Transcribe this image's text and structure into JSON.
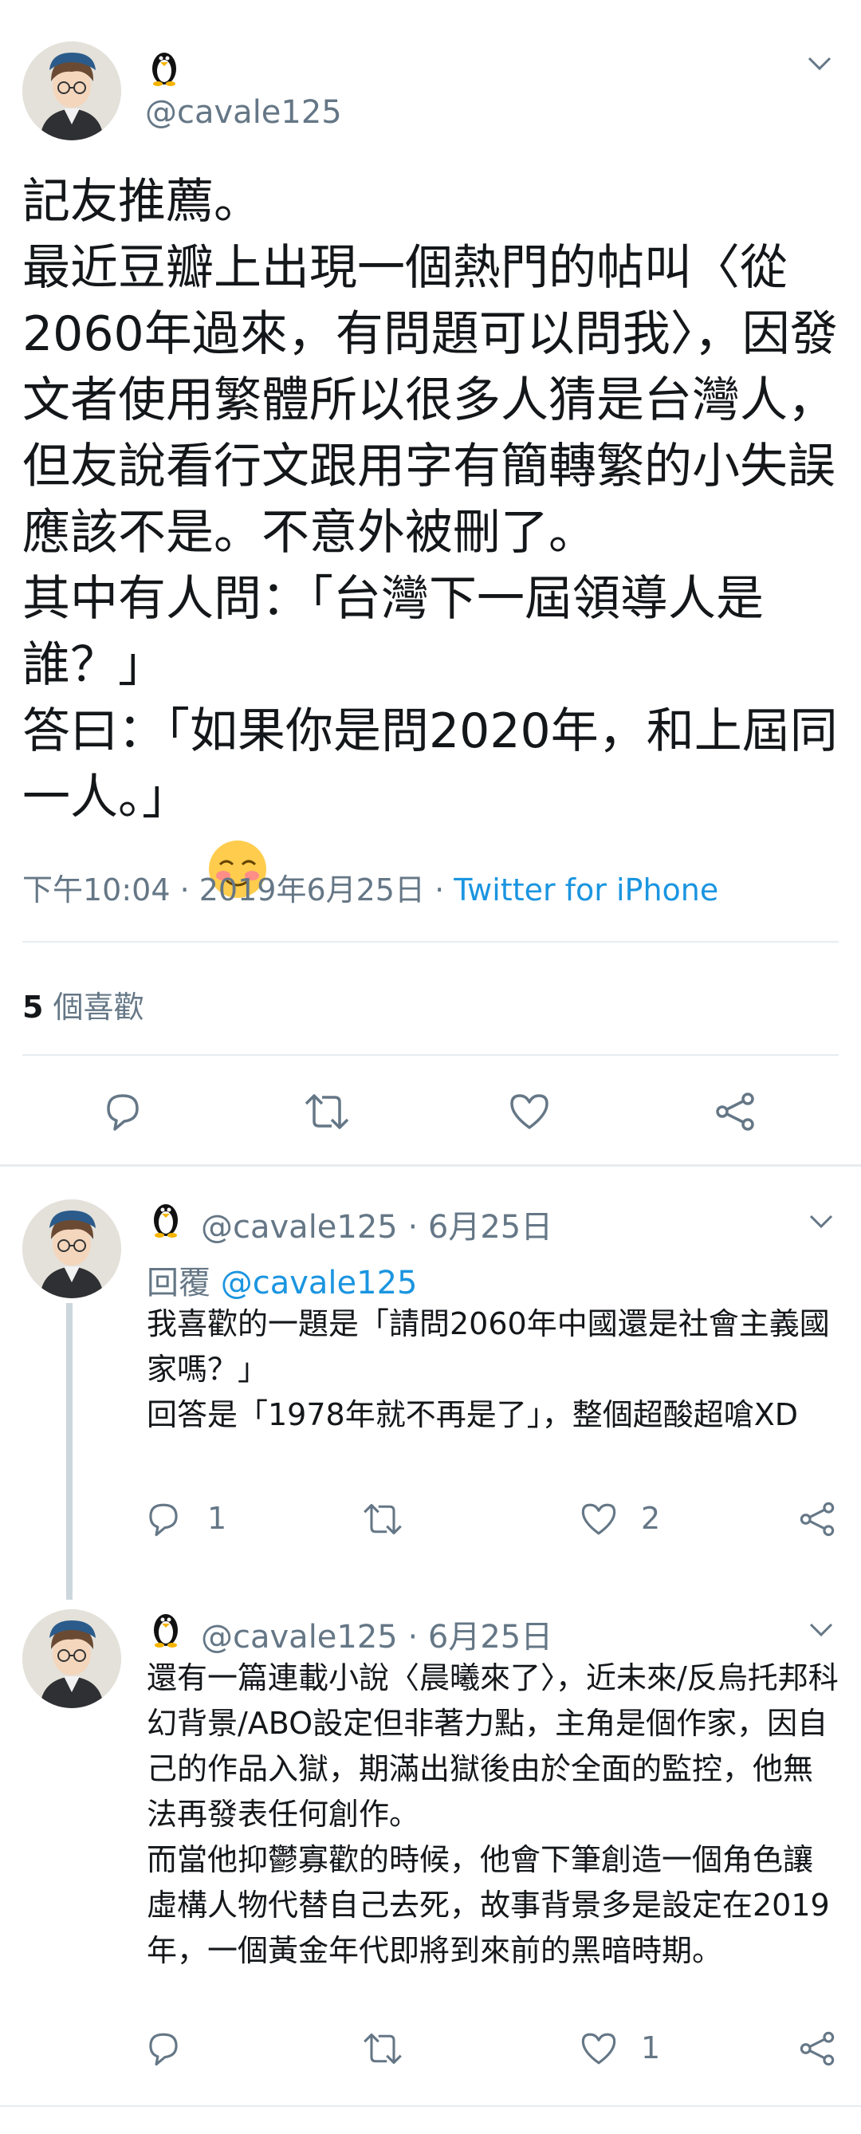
{
  "colors": {
    "text": "#14171a",
    "secondary": "#657786",
    "link": "#1b95e0",
    "divider": "#e6ecf0"
  },
  "main_tweet": {
    "avatar": "avatar-icon",
    "badge": "penguin-icon",
    "handle": "@cavale125",
    "text": "記友推薦。\n最近豆瓣上出現一個熱門的帖叫〈從2060年過來，有問題可以問我〉，因發文者使用繁體所以很多人猜是台灣人，但友說看行文跟用字有簡轉繁的小失誤應該不是。不意外被刪了。\n其中有人問：「台灣下一屆領導人是誰？」\n答曰：「如果你是問2020年，和上屆同一人。」",
    "emoji": "blushing-smile-emoji",
    "time": "下午10:04 · 2019年6月25日 · ",
    "source": "Twitter for iPhone",
    "likes_count": "5",
    "likes_label": " 個喜歡",
    "actions": [
      "reply-icon",
      "retweet-icon",
      "like-icon",
      "share-icon"
    ]
  },
  "replies": [
    {
      "handle": "@cavale125 · 6月25日",
      "reply_prefix": "回覆 ",
      "reply_to": "@cavale125",
      "text": "我喜歡的一題是「請問2060年中國還是社會主義國家嗎？」\n回答是「1978年就不再是了」，整個超酸超嗆XD",
      "reply_count": "1",
      "retweet_count": "",
      "like_count": "2"
    },
    {
      "handle": "@cavale125 · 6月25日",
      "text": "還有一篇連載小說〈晨曦來了〉，近未來/反烏托邦科幻背景/ABO設定但非著力點，主角是個作家，因自己的作品入獄，期滿出獄後由於全面的監控，他無法再發表任何創作。\n而當他抑鬱寡歡的時候，他會下筆創造一個角色讓虛構人物代替自己去死，故事背景多是設定在2019年，一個黃金年代即將到來前的黑暗時期。",
      "reply_count": "",
      "retweet_count": "",
      "like_count": "1"
    }
  ]
}
